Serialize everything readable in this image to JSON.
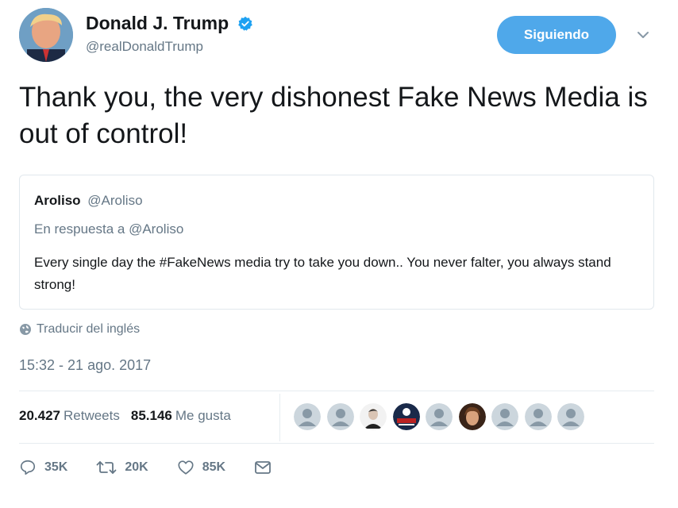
{
  "user": {
    "display_name": "Donald J. Trump",
    "handle": "@realDonaldTrump",
    "verified": true,
    "follow_label": "Siguiendo"
  },
  "tweet": {
    "text": "Thank you, the very dishonest Fake News Media is out of control!",
    "translate_label": "Traducir del inglés",
    "timestamp": "15:32 - 21 ago. 2017"
  },
  "quoted": {
    "name": "Aroliso",
    "handle": "@Aroliso",
    "reply_to": "En respuesta a @Aroliso",
    "text": "Every single day the #FakeNews media try to take you down.. You never falter, you always stand strong!"
  },
  "stats": {
    "retweets_count": "20.427",
    "retweets_label": "Retweets",
    "likes_count": "85.146",
    "likes_label": "Me gusta"
  },
  "likers": [
    "default",
    "default",
    "photo-man",
    "trump-badge",
    "default",
    "photo-woman",
    "default",
    "default",
    "default"
  ],
  "actions": {
    "reply_count": "35K",
    "retweet_count": "20K",
    "like_count": "85K"
  },
  "colors": {
    "accent": "#4fa8ea",
    "verified": "#1da1f2",
    "muted": "#657786"
  }
}
